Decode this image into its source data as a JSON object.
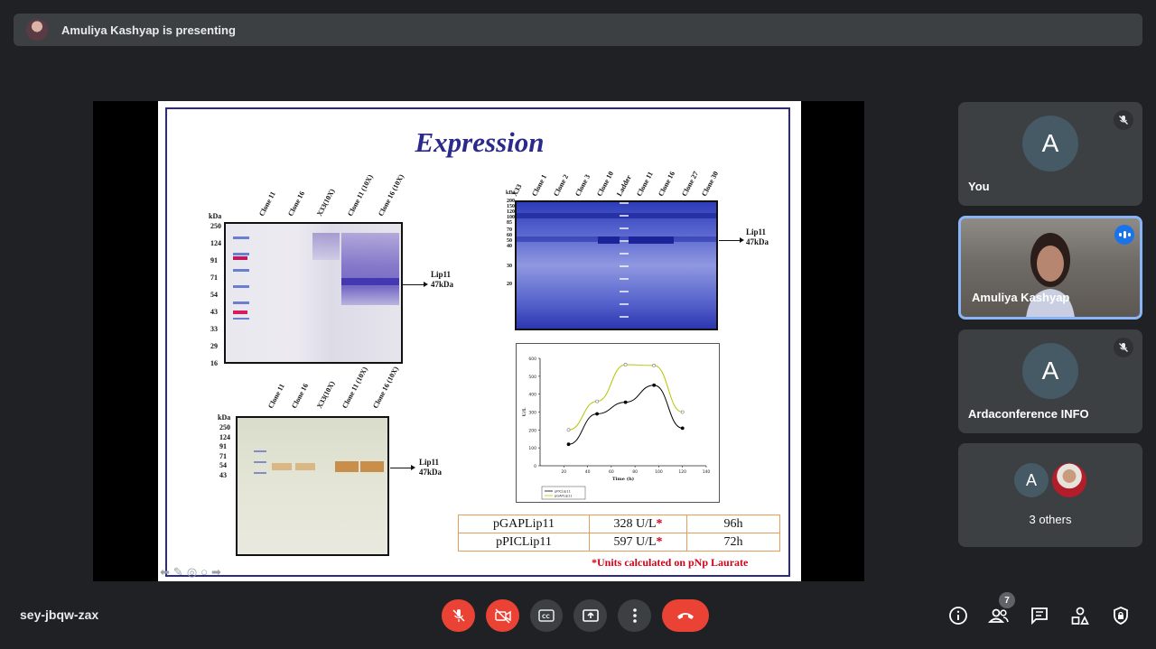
{
  "presenting_banner": {
    "text": "Amuliya Kashyap is presenting"
  },
  "slide": {
    "title": "Expression",
    "gel1": {
      "lanes": [
        "Clone 11",
        "Clone 16",
        "X33(10X)",
        "Clone 11 (10X)",
        "Clone 16 (10X)"
      ],
      "kda_header": "kDa",
      "markers": [
        "250",
        "124",
        "91",
        "71",
        "54",
        "43",
        "33",
        "29",
        "16"
      ],
      "band_label": [
        "Lip11",
        "47kDa"
      ]
    },
    "gel2": {
      "lanes": [
        "X33",
        "Clone 1",
        "Clone 2",
        "Clone 3",
        "Clone 10",
        "Ladder",
        "Clone 11",
        "Clone 16",
        "Clone 27",
        "Clone 30"
      ],
      "kda_header": "kDa",
      "markers": [
        "200",
        "150",
        "120",
        "100",
        "85",
        "70",
        "60",
        "50",
        "40",
        "30",
        "20"
      ],
      "band_label": [
        "Lip11",
        "47kDa"
      ]
    },
    "gel3": {
      "lanes": [
        "Clone 11",
        "Clone 16",
        "X33(10X)",
        "Clone 11 (10X)",
        "Clone 16 (10X)"
      ],
      "kda_header": "kDa",
      "markers": [
        "250",
        "124",
        "91",
        "71",
        "54",
        "43"
      ],
      "band_label": [
        "Lip11",
        "47kDa"
      ]
    },
    "table": {
      "rows": [
        {
          "name": "pGAPLip11",
          "activity": "328 U/L",
          "star": "*",
          "time": "96h"
        },
        {
          "name": "pPICLip11",
          "activity": "597 U/L",
          "star": "*",
          "time": "72h"
        }
      ]
    },
    "footnote": "*Units calculated on pNp Laurate"
  },
  "chart_data": {
    "type": "line",
    "xlabel": "Time (h)",
    "ylabel": "U/L",
    "xlim": [
      0,
      140
    ],
    "ylim": [
      0,
      600
    ],
    "xticks": [
      "20",
      "40",
      "60",
      "80",
      "100",
      "120",
      "140"
    ],
    "yticks": [
      "0",
      "100",
      "200",
      "300",
      "400",
      "500",
      "600"
    ],
    "series": [
      {
        "name": "pPICLip11",
        "color": "#000000",
        "x": [
          24,
          48,
          72,
          96,
          120
        ],
        "y": [
          120,
          290,
          355,
          450,
          210
        ]
      },
      {
        "name": "pGAPLip11",
        "color": "#b5c400",
        "x": [
          24,
          48,
          72,
          96,
          120
        ],
        "y": [
          200,
          360,
          565,
          560,
          300
        ]
      }
    ]
  },
  "participants": [
    {
      "name": "You",
      "initial": "A",
      "muted": true
    },
    {
      "name": "Amuliya Kashyap",
      "speaking": true
    },
    {
      "name": "Ardaconference INFO",
      "initial": "A",
      "muted": true
    },
    {
      "name": "3 others",
      "initial": "A"
    }
  ],
  "meeting_code": "sey-jbqw-zax",
  "people_count": "7",
  "colors": {
    "accent_red": "#ea4335",
    "speaking_blue": "#1a73e8",
    "tile_bg": "#3c4043"
  }
}
